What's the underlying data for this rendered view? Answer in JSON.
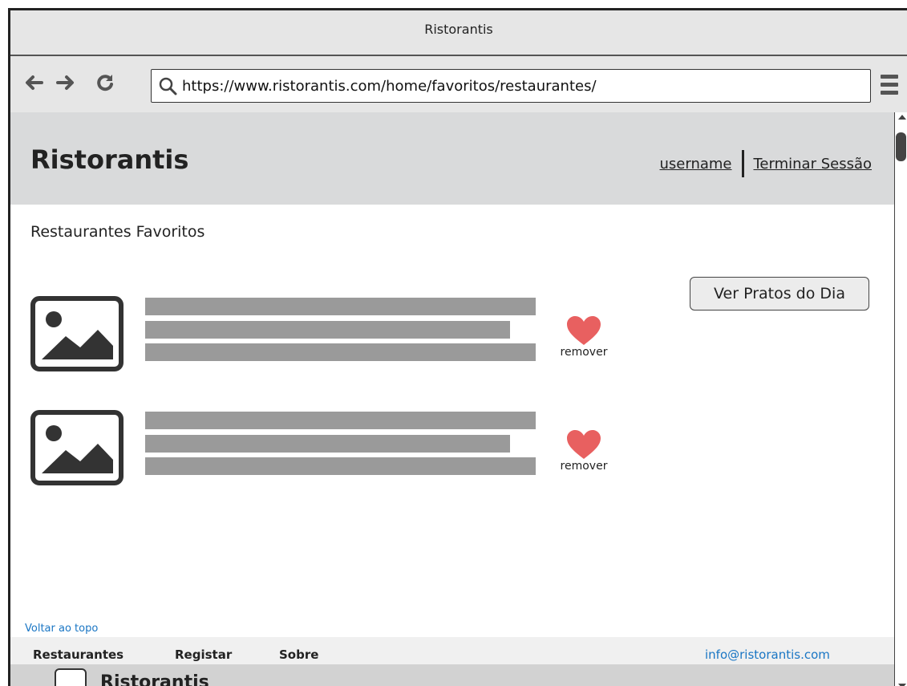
{
  "window": {
    "title": "Ristorantis"
  },
  "browser": {
    "url": "https://www.ristorantis.com/home/favoritos/restaurantes/"
  },
  "header": {
    "site_title": "Ristorantis",
    "username": "username",
    "logout": "Terminar Sessão"
  },
  "main": {
    "section_title": "Restaurantes Favoritos",
    "ver_pratos_button": "Ver Pratos do Dia",
    "items": [
      {
        "remove_label": "remover"
      },
      {
        "remove_label": "remover"
      }
    ]
  },
  "footer": {
    "back_to_top": "Voltar ao topo",
    "nav": [
      "Restaurantes",
      "Registar",
      "Sobre"
    ],
    "email": "info@ristorantis.com",
    "brand": "Ristorantis"
  },
  "colors": {
    "heart": "#e86060",
    "link_blue": "#1a76c4",
    "header_bg": "#d9dadb"
  }
}
